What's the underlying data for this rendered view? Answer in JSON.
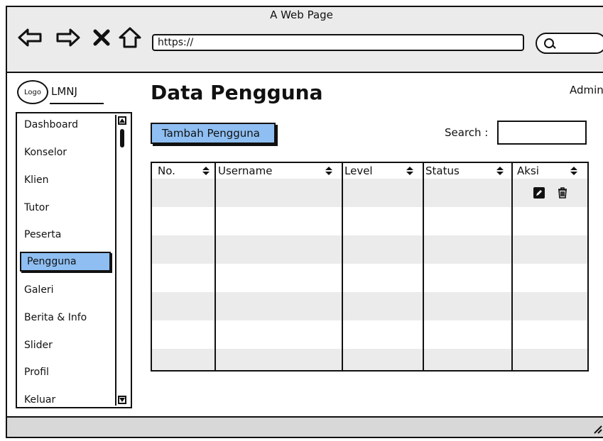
{
  "window": {
    "title": "A Web Page"
  },
  "browser": {
    "url": "https://",
    "nav": [
      "back-arrow-icon",
      "forward-arrow-icon",
      "close-x-icon",
      "home-icon"
    ]
  },
  "logo": {
    "mark": "Logo",
    "name": "LMNJ"
  },
  "sidebar": {
    "items": [
      {
        "label": "Dashboard"
      },
      {
        "label": "Konselor"
      },
      {
        "label": "Klien"
      },
      {
        "label": "Tutor"
      },
      {
        "label": "Peserta"
      },
      {
        "label": "Pengguna",
        "active": true
      },
      {
        "label": "Galeri"
      },
      {
        "label": "Berita & Info"
      },
      {
        "label": "Slider"
      },
      {
        "label": "Profil"
      },
      {
        "label": "Keluar"
      }
    ]
  },
  "header": {
    "title": "Data Pengguna",
    "user": "Admin"
  },
  "toolbar": {
    "add_label": "Tambah Pengguna",
    "search_label": "Search :",
    "search_value": ""
  },
  "table": {
    "columns": [
      {
        "label": "No."
      },
      {
        "label": "Username"
      },
      {
        "label": "Level"
      },
      {
        "label": "Status"
      },
      {
        "label": "Aksi"
      }
    ],
    "actions": [
      "edit-icon",
      "trash-icon"
    ]
  },
  "colors": {
    "accent": "#8fbff2",
    "row_shade": "#ebebeb",
    "chrome": "#ebebeb"
  }
}
